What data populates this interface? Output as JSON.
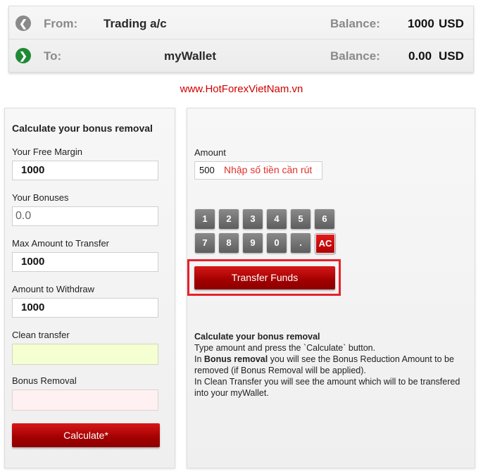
{
  "from_row": {
    "label": "From:",
    "account": "Trading a/c",
    "balance_label": "Balance:",
    "balance_value": "1000",
    "currency": "USD"
  },
  "to_row": {
    "label": "To:",
    "account": "myWallet",
    "balance_label": "Balance:",
    "balance_value": "0.00",
    "currency": "USD"
  },
  "watermark": "www.HotForexVietNam.vn",
  "calculator": {
    "title": "Calculate your bonus removal",
    "free_margin_label": "Your Free Margin",
    "free_margin_value": "1000",
    "bonuses_label": "Your Bonuses",
    "bonuses_value": "0.0",
    "max_transfer_label": "Max Amount to Transfer",
    "max_transfer_value": "1000",
    "withdraw_label": "Amount to Withdraw",
    "withdraw_value": "1000",
    "clean_transfer_label": "Clean transfer",
    "clean_transfer_value": "",
    "bonus_removal_label": "Bonus Removal",
    "bonus_removal_value": "",
    "calculate_button": "Calculate*"
  },
  "transfer": {
    "amount_label": "Amount",
    "amount_value": "500",
    "amount_note": "Nhập số tiền cần rút",
    "keypad_row1": [
      "1",
      "2",
      "3",
      "4",
      "5",
      "6"
    ],
    "keypad_row2": [
      "7",
      "8",
      "9",
      "0",
      ".",
      "AC"
    ],
    "transfer_button": "Transfer Funds",
    "highlight_color": "#e8212a"
  },
  "info": {
    "title": "Calculate your bonus removal",
    "line1": "Type amount and press the `Calculate` button.",
    "line2_prefix": "In ",
    "line2_bold": "Bonus removal",
    "line2_rest": " you will see the Bonus Reduction Amount to be removed (if Bonus Removal will be applied).",
    "line3": "In Clean Transfer you will see the amount which will to be transfered into your myWallet."
  },
  "icons": {
    "from": "arrow-left-circle-icon",
    "to": "arrow-right-circle-icon"
  },
  "colors": {
    "accent_red": "#c00000",
    "to_icon_green": "#1f8a35",
    "watermark_red": "#d00000"
  }
}
